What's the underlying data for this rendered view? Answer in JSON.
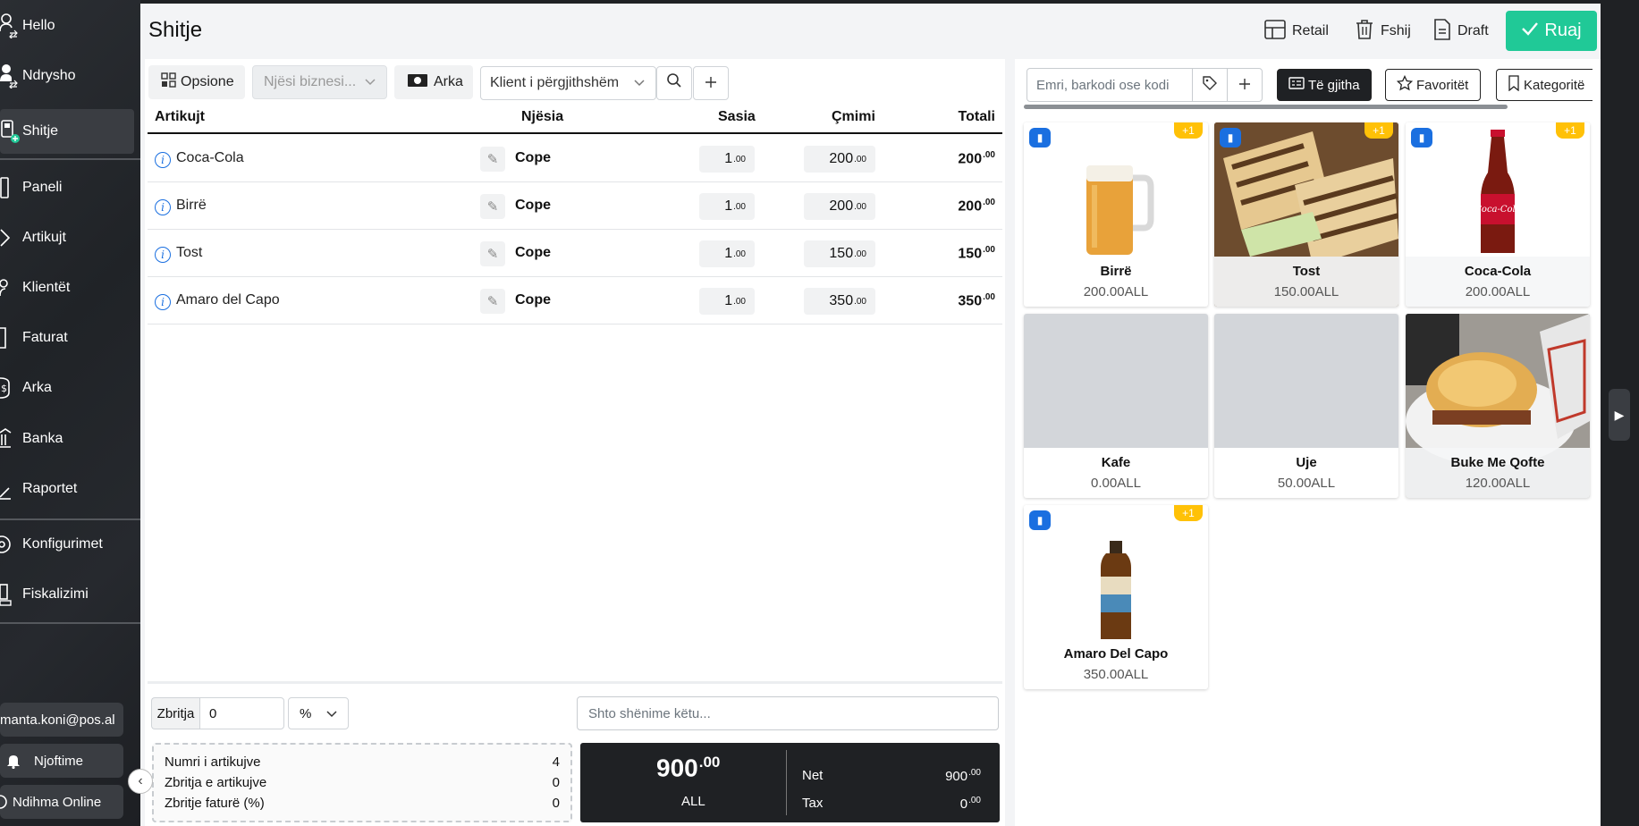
{
  "sidebar": {
    "items": [
      {
        "label": "Hello",
        "icon": "user-switch-icon"
      },
      {
        "label": "Ndrysho",
        "icon": "user-switch-icon"
      },
      {
        "label": "Shitje",
        "icon": "pos-terminal-icon"
      },
      {
        "label": "Paneli",
        "icon": "dashboard-icon"
      },
      {
        "label": "Artikujt",
        "icon": "tag-icon"
      },
      {
        "label": "Klientët",
        "icon": "users-icon"
      },
      {
        "label": "Faturat",
        "icon": "invoice-icon"
      },
      {
        "label": "Arka",
        "icon": "cash-register-icon"
      },
      {
        "label": "Banka",
        "icon": "bank-icon"
      },
      {
        "label": "Raportet",
        "icon": "chart-icon"
      },
      {
        "label": "Konfigurimet",
        "icon": "gear-icon"
      },
      {
        "label": "Fiskalizimi",
        "icon": "fiscal-icon"
      }
    ],
    "email": "manta.koni@pos.al",
    "notifications": "Njoftime",
    "help": "Ndihma Online"
  },
  "header": {
    "title": "Shitje",
    "retail": "Retail",
    "delete": "Fshij",
    "draft": "Draft",
    "save": "Ruaj"
  },
  "toolbar": {
    "options": "Opsione",
    "business_unit_placeholder": "Njësi biznesi...",
    "cash": "Arka",
    "client": "Klient i përgjithshëm"
  },
  "table": {
    "headers": {
      "item": "Artikujt",
      "unit": "Njësia",
      "qty": "Sasia",
      "price": "Çmimi",
      "total": "Totali"
    },
    "rows": [
      {
        "name": "Coca-Cola",
        "unit": "Cope",
        "qty": "1",
        "qty_dec": ".00",
        "price": "200",
        "price_dec": ".00",
        "total": "200",
        "total_dec": ".00"
      },
      {
        "name": "Birrë",
        "unit": "Cope",
        "qty": "1",
        "qty_dec": ".00",
        "price": "200",
        "price_dec": ".00",
        "total": "200",
        "total_dec": ".00"
      },
      {
        "name": "Tost",
        "unit": "Cope",
        "qty": "1",
        "qty_dec": ".00",
        "price": "150",
        "price_dec": ".00",
        "total": "150",
        "total_dec": ".00"
      },
      {
        "name": "Amaro del Capo",
        "unit": "Cope",
        "qty": "1",
        "qty_dec": ".00",
        "price": "350",
        "price_dec": ".00",
        "total": "350",
        "total_dec": ".00"
      }
    ]
  },
  "discount": {
    "label": "Zbritja",
    "value": "0",
    "type": "%"
  },
  "notes_placeholder": "Shto shënime këtu...",
  "summary": {
    "items_count_label": "Numri i artikujve",
    "items_count": "4",
    "items_discount_label": "Zbritja e artikujve",
    "items_discount": "0",
    "invoice_discount_label": "Zbritje faturë (%)",
    "invoice_discount": "0"
  },
  "totals": {
    "total": "900",
    "total_dec": ".00",
    "currency": "ALL",
    "net_label": "Net",
    "net": "900",
    "net_dec": ".00",
    "tax_label": "Tax",
    "tax": "0",
    "tax_dec": ".00"
  },
  "catalog": {
    "search_placeholder": "Emri, barkodi ose kodi",
    "filter_all": "Të gjitha",
    "filter_fav": "Favoritët",
    "filter_cat": "Kategoritë",
    "products": [
      {
        "name": "Birrë",
        "price": "200.00ALL",
        "badge": "+1",
        "img": "beer"
      },
      {
        "name": "Tost",
        "price": "150.00ALL",
        "badge": "+1",
        "img": "toast"
      },
      {
        "name": "Coca-Cola",
        "price": "200.00ALL",
        "badge": "+1",
        "img": "cola"
      },
      {
        "name": "Kafe",
        "price": "0.00ALL",
        "badge": "",
        "img": "none"
      },
      {
        "name": "Uje",
        "price": "50.00ALL",
        "badge": "",
        "img": "none"
      },
      {
        "name": "Buke Me Qofte",
        "price": "120.00ALL",
        "badge": "",
        "img": "burger"
      },
      {
        "name": "Amaro Del Capo",
        "price": "350.00ALL",
        "badge": "+1",
        "img": "amaro"
      }
    ]
  },
  "colors": {
    "accent": "#20c997",
    "sidebar": "#202327",
    "badge": "#ffc107",
    "bookmark": "#1a6fe0"
  }
}
